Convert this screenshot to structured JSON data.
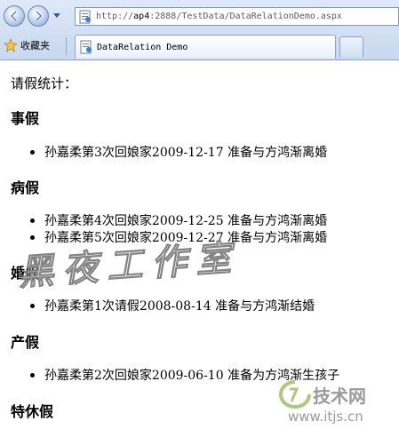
{
  "browser": {
    "address": {
      "prefix": "http://",
      "host": "ap4",
      "path": ":2888/TestData/DataRelationDemo.aspx"
    },
    "favorites_label": "收藏夹",
    "tab_title": "DataRelation Demo"
  },
  "page": {
    "intro": "请假统计：",
    "categories": [
      {
        "name": "事假",
        "items": [
          "孙嘉柔第3次回娘家2009-12-17 准备与方鸿渐离婚"
        ]
      },
      {
        "name": "病假",
        "items": [
          "孙嘉柔第4次回娘家2009-12-25 准备与方鸿渐离婚",
          "孙嘉柔第5次回娘家2009-12-27 准备与方鸿渐离婚"
        ]
      },
      {
        "name": "婚假",
        "items": [
          "孙嘉柔第1次请假2008-08-14 准备与方鸿渐结婚"
        ]
      },
      {
        "name": "产假",
        "items": [
          "孙嘉柔第2次回娘家2009-06-10 准备为方鸿渐生孩子"
        ]
      },
      {
        "name": "特休假",
        "items": []
      }
    ]
  },
  "watermarks": {
    "center_text": "黑夜工作室",
    "logo_name": "技术网",
    "logo_url": "www.itjs.cn"
  },
  "colors": {
    "chrome_bg": "#dfe9f8",
    "chrome_border": "#8ea4c6"
  }
}
